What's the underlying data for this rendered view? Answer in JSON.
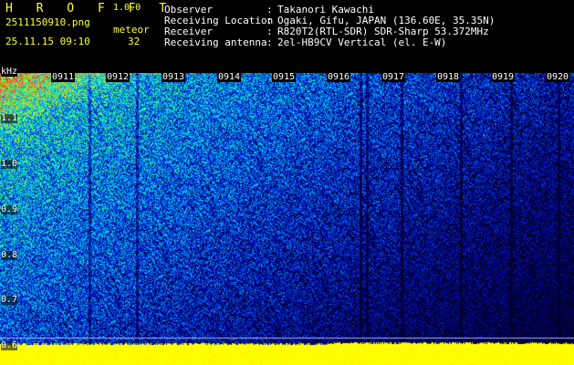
{
  "header": {
    "app_title": "H R O F F T",
    "version": "1.0.0",
    "filename": "2511150910.png",
    "datetime": "25.11.15 09:10",
    "meteor_label": "meteor",
    "meteor_count": "32"
  },
  "meta": [
    {
      "label": "Observer",
      "value": "Takanori Kawachi"
    },
    {
      "label": "Receiving Location",
      "value": "Ogaki, Gifu, JAPAN (136.60E, 35.35N)"
    },
    {
      "label": "Receiver",
      "value": "R820T2(RTL-SDR) SDR-Sharp 53.372MHz"
    },
    {
      "label": "Receiving antenna",
      "value": "2el-HB9CV Vertical (el. E-W)"
    }
  ],
  "meta_separator": ":",
  "axes": {
    "freq_unit": "kHz",
    "time_ticks": [
      "0911",
      "0912",
      "0913",
      "0914",
      "0915",
      "0916",
      "0917",
      "0918",
      "0919",
      "0920"
    ],
    "freq_ticks": [
      "1.1",
      "1.0",
      "0.9",
      "0.8",
      "0.7",
      "0.6"
    ]
  },
  "colors": {
    "header_text": "#ffff33",
    "meta_text": "#ffffff",
    "background": "#000000",
    "noise_floor": "#ffff00"
  }
}
